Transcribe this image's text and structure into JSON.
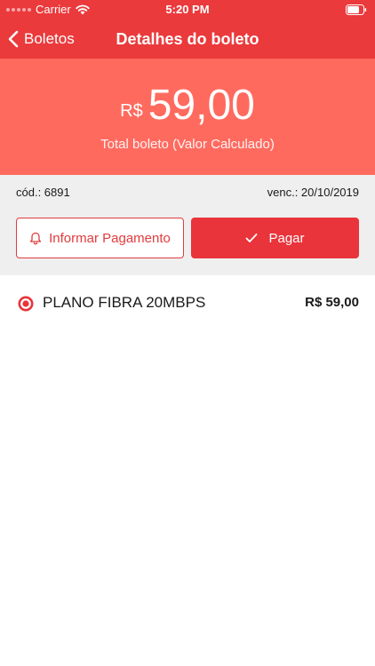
{
  "status_bar": {
    "carrier": "Carrier",
    "time": "5:20 PM",
    "signal_icon": "signal-dots-icon",
    "wifi_icon": "wifi-icon",
    "battery_icon": "battery-icon"
  },
  "nav": {
    "back_label": "Boletos",
    "back_icon": "chevron-left-icon",
    "title": "Detalhes do boleto"
  },
  "hero": {
    "currency": "R$",
    "amount": "59,00",
    "caption": "Total boleto (Valor Calculado)"
  },
  "details": {
    "code": "cód.: 6891",
    "due": "venc.: 20/10/2019"
  },
  "actions": {
    "inform_label": "Informar Pagamento",
    "inform_icon": "bell-icon",
    "pay_label": "Pagar",
    "pay_icon": "check-icon"
  },
  "items": [
    {
      "label": "PLANO FIBRA 20MBPS",
      "price": "R$ 59,00",
      "icon": "radio-selected-icon"
    }
  ],
  "colors": {
    "primary": "#ea3a3c",
    "hero": "#ff6a5f",
    "panel": "#efefef"
  }
}
